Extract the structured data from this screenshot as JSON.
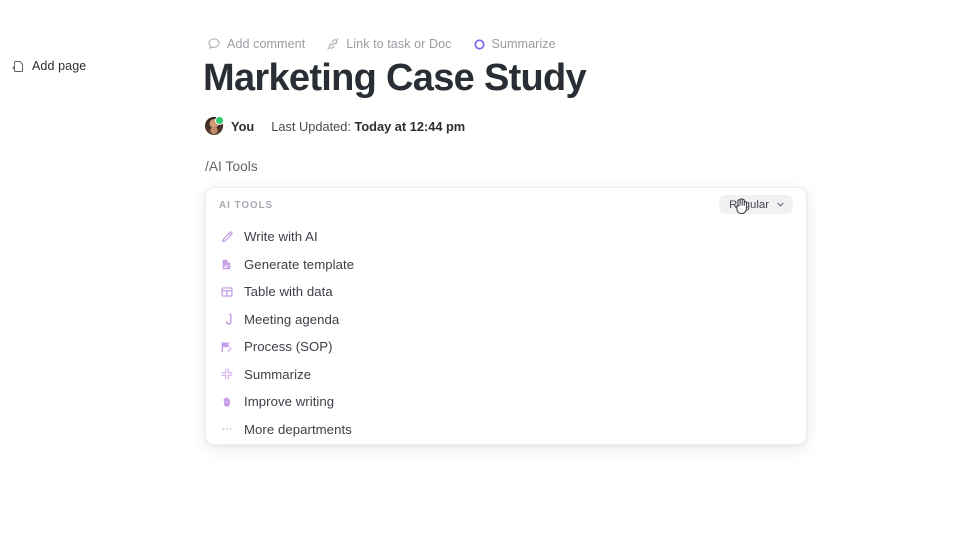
{
  "sidebar": {
    "add_page": {
      "label": "Add page",
      "icon": "add-page-icon"
    }
  },
  "doc": {
    "toolbar": [
      {
        "label": "Add comment",
        "icon": "comment-icon"
      },
      {
        "label": "Link to task or Doc",
        "icon": "unlink-icon"
      },
      {
        "label": "Summarize",
        "icon": "ai-circle-icon"
      }
    ],
    "title": "Marketing Case Study",
    "author": "You",
    "updated_prefix": "Last Updated:",
    "updated_value": "Today at 12:44 pm",
    "slash_command": "/AI Tools"
  },
  "ai_popover": {
    "caption": "AI TOOLS",
    "tone": {
      "label": "Regular",
      "icon": "chevron-down-icon"
    },
    "items": [
      {
        "label": "Write with AI",
        "icon": "pencil-icon"
      },
      {
        "label": "Generate template",
        "icon": "document-icon"
      },
      {
        "label": "Table with data",
        "icon": "table-icon"
      },
      {
        "label": "Meeting agenda",
        "icon": "phone-icon"
      },
      {
        "label": "Process (SOP)",
        "icon": "flag-edit-icon"
      },
      {
        "label": "Summarize",
        "icon": "collapse-icon"
      },
      {
        "label": "Improve writing",
        "icon": "hand-sparkle-icon"
      },
      {
        "label": "More departments",
        "icon": "ellipsis-icon"
      }
    ]
  },
  "colors": {
    "accent_purple": "#bf93e4",
    "brand_purple": "#7b68ee",
    "status_green": "#2ecc71",
    "text_dark": "#292d34",
    "text_muted": "#9c9ca6"
  }
}
